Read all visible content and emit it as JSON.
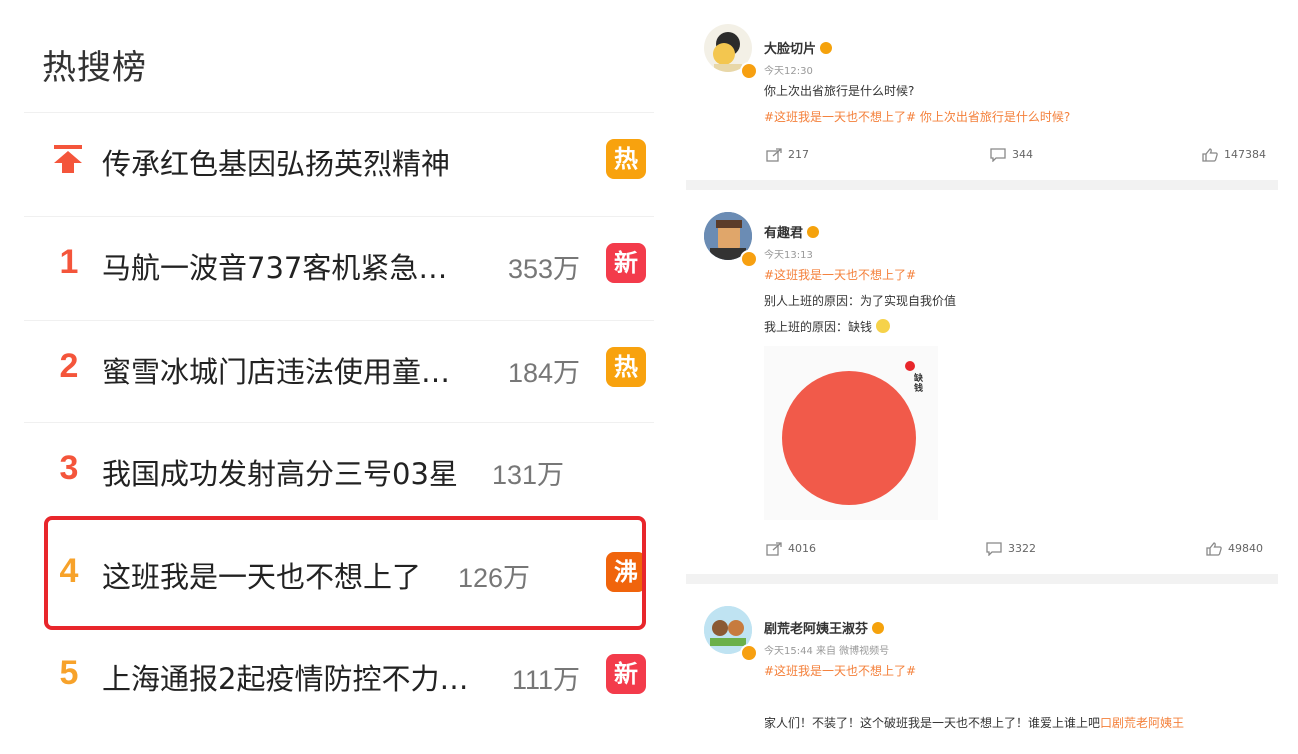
{
  "left": {
    "title": "热搜榜",
    "rows": [
      {
        "rank": "",
        "text": "传承红色基因弘扬英烈精神",
        "heat": "",
        "badge": "热"
      },
      {
        "rank": "1",
        "text": "马航一波音737客机紧急…",
        "heat": "353万",
        "badge": "新"
      },
      {
        "rank": "2",
        "text": "蜜雪冰城门店违法使用童…",
        "heat": "184万",
        "badge": "热"
      },
      {
        "rank": "3",
        "text": "我国成功发射高分三号03星",
        "heat": "131万",
        "badge": ""
      },
      {
        "rank": "4",
        "text": "这班我是一天也不想上了",
        "heat": "126万",
        "badge": "沸"
      },
      {
        "rank": "5",
        "text": "上海通报2起疫情防控不力…",
        "heat": "111万",
        "badge": "新"
      }
    ]
  },
  "posts": [
    {
      "username": "大脸切片",
      "time": "今天12:30",
      "text": "你上次出省旅行是什么时候?",
      "topic_line": "#这班我是一天也不想上了# 你上次出省旅行是什么时候?",
      "reposts": "217",
      "comments": "344",
      "likes": "147384"
    },
    {
      "username": "有趣君",
      "time": "今天13:13",
      "topic_line": "#这班我是一天也不想上了#",
      "line1": "别人上班的原因：为了实现自我价值",
      "line2": "我上班的原因：缺钱",
      "pie_label": "缺钱",
      "reposts": "4016",
      "comments": "3322",
      "likes": "49840"
    },
    {
      "username": "剧荒老阿姨王淑芬",
      "time": "今天15:44  来自 微博视频号",
      "topic_line": "#这班我是一天也不想上了#",
      "text": "家人们！不装了！这个破班我是一天也不想上了！谁爱上谁上吧",
      "text_tail": "口剧荒老阿姨王"
    }
  ],
  "colors": {
    "rank_top3": "#f4553b",
    "rank_other": "#f7a22a",
    "badge_hot": "#f8a20e",
    "badge_new": "#f33b4b",
    "badge_boil": "#f0640c",
    "highlight": "#e8262b",
    "topic": "#f4803b",
    "pie": "#f15a4a"
  }
}
